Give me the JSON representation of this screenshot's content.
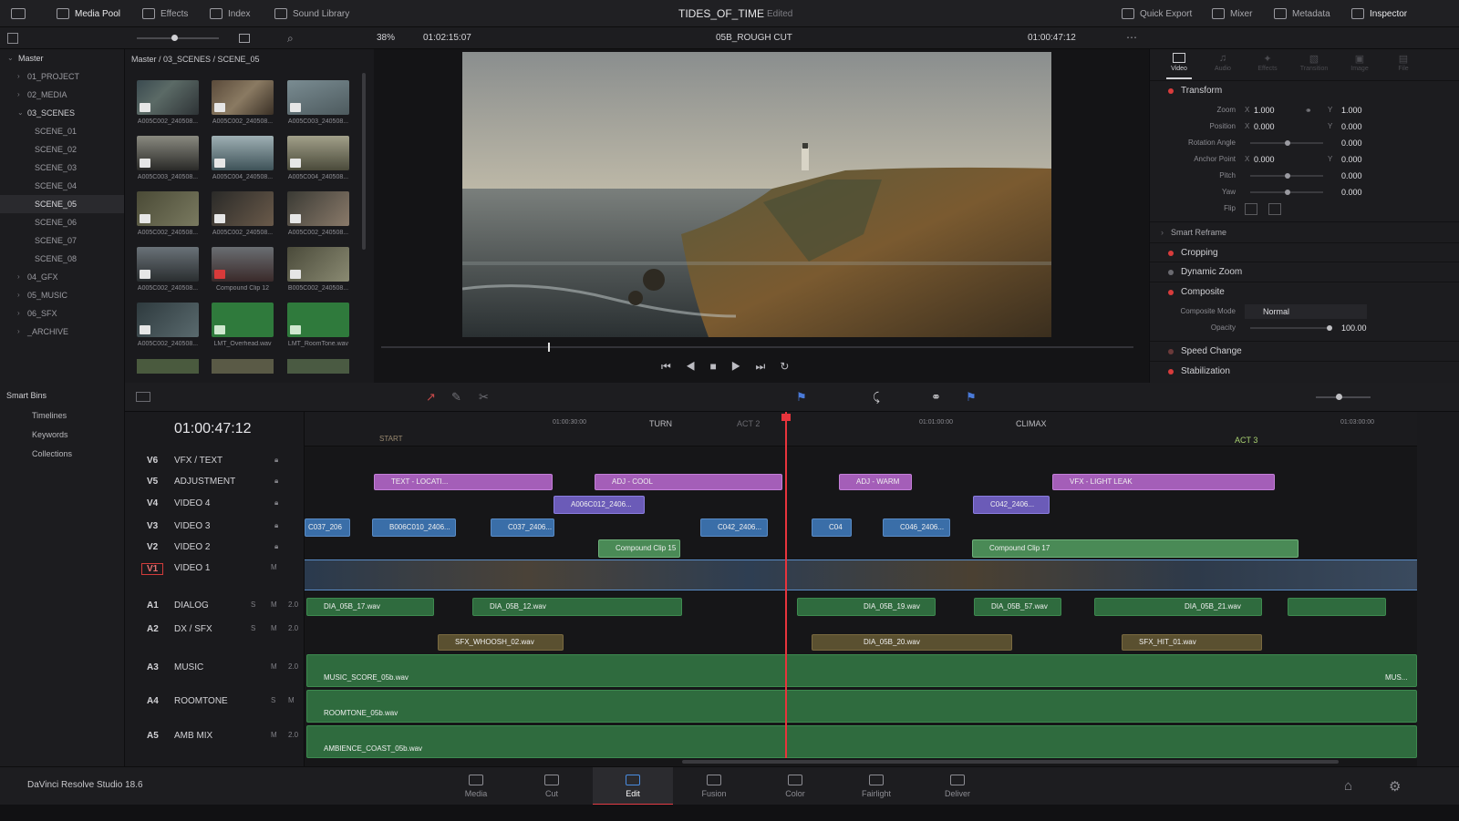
{
  "topbar": {
    "media_pool": "Media Pool",
    "effects": "Effects",
    "index": "Index",
    "sound_library": "Sound Library",
    "project_title": "TIDES_OF_TIME",
    "project_status": "Edited",
    "quick_export": "Quick Export",
    "mixer": "Mixer",
    "metadata": "Metadata",
    "inspector": "Inspector"
  },
  "viewer_bar": {
    "zoom": "38%",
    "source_tc": "01:02:15:07",
    "timeline_name": "05B_ROUGH CUT",
    "record_tc": "01:00:47:12"
  },
  "bins": {
    "master": "Master",
    "items": [
      "01_PROJECT",
      "02_MEDIA",
      "03_SCENES",
      "SCENE_01",
      "SCENE_02",
      "SCENE_03",
      "SCENE_04",
      "SCENE_05",
      "SCENE_06",
      "SCENE_07",
      "SCENE_08",
      "04_GFX",
      "05_MUSIC",
      "06_SFX",
      "_ARCHIVE"
    ]
  },
  "mediapool": {
    "path": "Master / 03_SCENES / SCENE_05",
    "clips": [
      "A005C002_240508...",
      "A005C002_240508...",
      "A005C003_240508...",
      "A005C003_240508...",
      "A005C004_240508...",
      "A005C004_240508...",
      "A005C002_240508...",
      "A005C002_240508...",
      "A005C002_240508...",
      "A005C002_240508...",
      "Compound Clip 12",
      "B005C002_240508...",
      "A005C002_240508...",
      "LMT_Overhead.wav",
      "LMT_RoomTone.wav"
    ]
  },
  "inspector": {
    "tabs": [
      "Video",
      "Audio",
      "Effects",
      "Transition",
      "Image",
      "File"
    ],
    "transform": "Transform",
    "zoom_label": "Zoom",
    "zoom_x": "1.000",
    "zoom_y": "1.000",
    "position_label": "Position",
    "position_x": "0.000",
    "position_y": "0.000",
    "rotation_label": "Rotation Angle",
    "rotation": "0.000",
    "anchor_label": "Anchor Point",
    "anchor_x": "0.000",
    "anchor_y": "0.000",
    "pitch_label": "Pitch",
    "pitch": "0.000",
    "yaw_label": "Yaw",
    "yaw": "0.000",
    "flip_label": "Flip",
    "smart_reframe": "Smart Reframe",
    "cropping": "Cropping",
    "dynamic_zoom": "Dynamic Zoom",
    "composite": "Composite",
    "composite_mode_label": "Composite Mode",
    "composite_mode": "Normal",
    "opacity_label": "Opacity",
    "opacity": "100.00",
    "speed_change": "Speed Change",
    "stabilization": "Stabilization"
  },
  "smart_bins": {
    "title": "Smart Bins",
    "items": [
      "Timelines",
      "Keywords",
      "Collections"
    ]
  },
  "timeline": {
    "timecode": "01:00:47:12",
    "ruler": [
      "01:00:30:00",
      "01:01:00:00",
      "01:03:00:00"
    ],
    "markers": [
      "START",
      "TURN",
      "ACT 2",
      "CLIMAX",
      "ACT 3"
    ],
    "tracks": [
      {
        "id": "V6",
        "name": "VFX / TEXT"
      },
      {
        "id": "V5",
        "name": "ADJUSTMENT"
      },
      {
        "id": "V4",
        "name": "VIDEO 4"
      },
      {
        "id": "V3",
        "name": "VIDEO 3"
      },
      {
        "id": "V2",
        "name": "VIDEO 2"
      },
      {
        "id": "V1",
        "name": "VIDEO 1"
      },
      {
        "id": "A1",
        "name": "DIALOG",
        "level": "2.0"
      },
      {
        "id": "A2",
        "name": "DX / SFX",
        "level": "2.0"
      },
      {
        "id": "A3",
        "name": "MUSIC",
        "level": "2.0"
      },
      {
        "id": "A4",
        "name": "ROOMTONE"
      },
      {
        "id": "A5",
        "name": "AMB MIX",
        "level": "2.0"
      }
    ],
    "clips": {
      "text_local": "TEXT - LOCATI...",
      "adj_cool": "ADJ - COOL",
      "adj_warm": "ADJ - WARM",
      "vfx_light": "VFX - LIGHT LEAK",
      "a006": "A006C012_2406...",
      "c042a": "C042_2406...",
      "c037": "C037_206",
      "b006": "B006C010_2406...",
      "c037b": "C037_2406...",
      "c042b": "C042_2406...",
      "c04": "C04",
      "c046": "C046_2406...",
      "cc15": "Compound Clip 15",
      "cc17": "Compound Clip 17",
      "dia17": "DIA_05B_17.wav",
      "dia12": "DIA_05B_12.wav",
      "dia19": "DIA_05B_19.wav",
      "dia57": "DIA_05B_57.wav",
      "dia21": "DIA_05B_21.wav",
      "whoosh": "SFX_WHOOSH_02.wav",
      "dia20": "DIA_05B_20.wav",
      "sfxhit": "SFX_HIT_01.wav",
      "music": "MUSIC_SCORE_05b.wav",
      "music2": "MUS...",
      "room": "ROOMTONE_05b.wav",
      "amb": "AMBIENCE_COAST_05b.wav"
    }
  },
  "pages": [
    "Media",
    "Cut",
    "Edit",
    "Fusion",
    "Color",
    "Fairlight",
    "Deliver"
  ],
  "app_name": "DaVinci Resolve Studio 18.6",
  "colors": {
    "accent_red": "#e23b45",
    "playhead": "#e8343c",
    "v1_blue": "#3a6ea8"
  }
}
